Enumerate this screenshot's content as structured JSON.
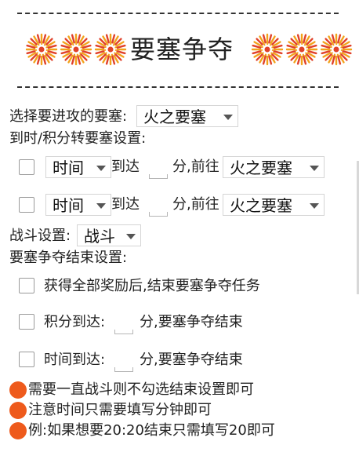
{
  "header": {
    "dashes": "------------------------------------------------",
    "title": "要塞争夺"
  },
  "icons": {
    "decoration": "sun-burst-icon",
    "note": "orange-dot-icon"
  },
  "colors": {
    "sun_orange": "#f2a21a",
    "sun_red": "#e0412b",
    "dot": "#ee5a1c"
  },
  "fortress_select": {
    "label": "选择要进攻的要塞:",
    "value": "火之要塞"
  },
  "transfer_section": {
    "label": "到时/积分转要塞设置:"
  },
  "transfer_rules": [
    {
      "checked": false,
      "mode": "时间",
      "arrive": "到达",
      "value": "",
      "unit_go": "分,前往",
      "target": "火之要塞"
    },
    {
      "checked": false,
      "mode": "时间",
      "arrive": "到达",
      "value": "",
      "unit_go": "分,前往",
      "target": "火之要塞"
    }
  ],
  "battle": {
    "label": "战斗设置:",
    "value": "战斗"
  },
  "end_section": {
    "label": "要塞争夺结束设置:"
  },
  "end_rules": [
    {
      "checked": false,
      "text": "获得全部奖励后,结束要塞争夺任务"
    },
    {
      "checked": false,
      "prefix": "积分到达:",
      "value": "",
      "suffix": "分,要塞争夺结束"
    },
    {
      "checked": false,
      "prefix": "时间到达:",
      "value": "",
      "suffix": "分,要塞争夺结束"
    }
  ],
  "notes": [
    "需要一直战斗则不勾选结束设置即可",
    "注意时间只需要填写分钟即可",
    "例:如果想要20:20结束只需填写20即可"
  ]
}
